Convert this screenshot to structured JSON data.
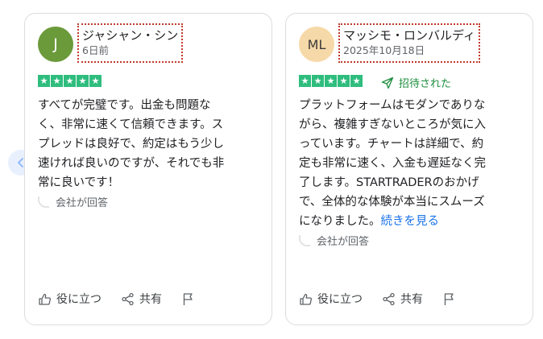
{
  "reviews": [
    {
      "avatar_initials": "J",
      "avatar_color": "#6b9a3a",
      "name": "ジャシャン・シン",
      "date": "6日前",
      "rating": 5,
      "invited_label": "",
      "text_lines": [
        "すべてが完璧です。出金も問題な",
        "く、非常に速くて信頼できます。ス",
        "プレッドは良好で、約定はもう少し",
        "速ければ良いのですが、それでも非",
        "常に良いです！"
      ],
      "more_link": "",
      "company_reply": "会社が回答"
    },
    {
      "avatar_initials": "ML",
      "avatar_color": "#f6d9a8",
      "name": "マッシモ・ロンバルディ",
      "date": "2025年10月18日",
      "rating": 5,
      "invited_label": "招待された",
      "text_lines": [
        "プラットフォームはモダンでありな",
        "がら、複雑すぎないところが気に入",
        "っています。チャートは詳細で、約",
        "定も非常に速く、入金も遅延なく完",
        "了します。STARTRADERのおかげ",
        "で、全体的な体験が本当にスムーズ",
        "になりました。"
      ],
      "more_link": "続きを見る",
      "company_reply": "会社が回答"
    }
  ],
  "actions": {
    "helpful_label": "役に立つ",
    "share_label": "共有"
  },
  "icons": {
    "prev": "chevron-left-icon",
    "helpful": "thumbs-up-icon",
    "share": "share-icon",
    "flag": "flag-icon",
    "invited": "send-icon",
    "star": "star-icon"
  },
  "colors": {
    "star_green": "#2fbd7e",
    "invited_green": "#1e8e3e",
    "link_blue": "#1a73e8",
    "highlight_border": "#c0392b"
  }
}
